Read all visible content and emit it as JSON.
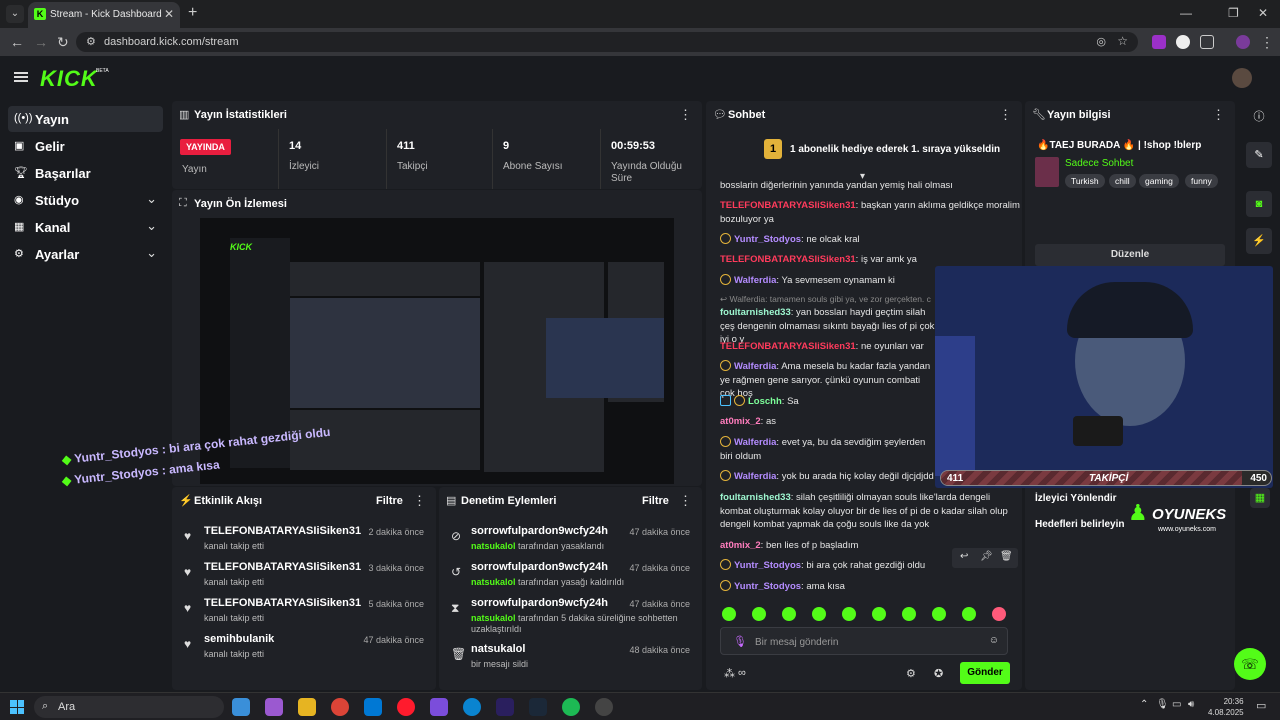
{
  "browser": {
    "tab_title": "Stream - Kick Dashboard",
    "url": "dashboard.kick.com/stream"
  },
  "header": {
    "logo": "KICK",
    "beta": "BETA"
  },
  "sidebar": {
    "items": [
      {
        "label": "Yayın",
        "icon": "broadcast-icon"
      },
      {
        "label": "Gelir",
        "icon": "revenue-icon"
      },
      {
        "label": "Başarılar",
        "icon": "trophy-icon"
      },
      {
        "label": "Stüdyo",
        "icon": "studio-icon"
      },
      {
        "label": "Kanal",
        "icon": "channel-icon"
      },
      {
        "label": "Ayarlar",
        "icon": "gear-icon"
      }
    ]
  },
  "stats": {
    "title": "Yayın İstatistikleri",
    "live_badge": "YAYINDA",
    "live_label": "Yayın",
    "viewers_value": "14",
    "viewers_label": "İzleyici",
    "followers_value": "411",
    "followers_label": "Takipçi",
    "subs_value": "9",
    "subs_label": "Abone Sayısı",
    "uptime_value": "00:59:53",
    "uptime_label_1": "Yayında Olduğu",
    "uptime_label_2": "Süre"
  },
  "preview": {
    "title": "Yayın Ön İzlemesi",
    "overlay_line1": "Yuntr_Stodyos : bi ara çok rahat gezdiği oldu",
    "overlay_line2": "Yuntr_Stodyos : ama kısa"
  },
  "activity": {
    "title": "Etkinlik Akışı",
    "filter": "Filtre",
    "rows": [
      {
        "name": "TELEFONBATARYASIiSiken31",
        "sub": "kanalı takip etti",
        "time": "2 dakika önce"
      },
      {
        "name": "TELEFONBATARYASIiSiken31",
        "sub": "kanalı takip etti",
        "time": "3 dakika önce"
      },
      {
        "name": "TELEFONBATARYASIiSiken31",
        "sub": "kanalı takip etti",
        "time": "5 dakika önce"
      },
      {
        "name": "semihbulanik",
        "sub": "kanalı takip etti",
        "time": "47 dakika önce"
      }
    ]
  },
  "moderation": {
    "title": "Denetim Eylemleri",
    "filter": "Filtre",
    "rows": [
      {
        "name": "sorrowfulpardon9wcfy24h",
        "mod": "natsukalol",
        "sub": "tarafından yasaklandı",
        "time": "47 dakika önce"
      },
      {
        "name": "sorrowfulpardon9wcfy24h",
        "mod": "natsukalol",
        "sub": "tarafından yasağı kaldırıldı",
        "time": "47 dakika önce"
      },
      {
        "name": "sorrowfulpardon9wcfy24h",
        "mod": "natsukalol",
        "sub": "tarafından 5 dakika süreliğine sohbetten",
        "sub2": "uzaklaştırıldı",
        "time": "47 dakika önce"
      },
      {
        "name": "natsukalol",
        "mod": "",
        "sub": "bir mesajı sildi",
        "time": "48 dakika önce"
      }
    ]
  },
  "chat": {
    "title": "Sohbet",
    "pinned": "1 abonelik hediye ederek 1. sıraya yükseldin",
    "pinned_rank": "1",
    "messages": [
      {
        "user": "",
        "cls": "",
        "text": "bosslarin diğerlerinin yanında yandan yemiş hali olması"
      },
      {
        "user": "TELEFONBATARYASIiSiken31",
        "cls": "u-red",
        "text": "başkan yarın aklıma geldikçe moralim bozuluyor ya"
      },
      {
        "user": "Yuntr_Stodyos",
        "cls": "u-purple",
        "text": "ne olcak kral"
      },
      {
        "user": "TELEFONBATARYASIiSiken31",
        "cls": "u-red",
        "text": "iş var amk ya"
      },
      {
        "user": "Walferdia",
        "cls": "u-purple",
        "text": "Ya sevmesem oynamam ki"
      },
      {
        "user": "foultarnished33",
        "cls": "u-mint",
        "text": "yan bossları haydi geçtim silah çeş dengenin olmaması sıkıntı bayağı lies of pi çok iyi o y",
        "reply": "Walferdia: tamamen souls gibi ya, ve zor gerçekten. c"
      },
      {
        "user": "TELEFONBATARYASIiSiken31",
        "cls": "u-red",
        "text": "ne oyunları var"
      },
      {
        "user": "Walferdia",
        "cls": "u-purple",
        "text": "Ama mesela bu kadar fazla yandan ye rağmen gene sarıyor. çünkü oyunun combati çok hoş"
      },
      {
        "user": "Loschh",
        "cls": "u-green",
        "text": "Sa"
      },
      {
        "user": "at0mix_2",
        "cls": "u-pink",
        "text": "as"
      },
      {
        "user": "Walferdia",
        "cls": "u-purple",
        "text": "evet ya, bu da sevdiğim şeylerden biri oldum"
      },
      {
        "user": "Walferdia",
        "cls": "u-purple",
        "text": "yok bu arada hiç kolay değil djcjdjdd"
      },
      {
        "user": "foultarnished33",
        "cls": "u-mint",
        "text": "silah çeşitliliği olmayan souls like'larda dengeli kombat oluşturmak kolay oluyor bir de lies of pi de o kadar silah olup dengeli kombat yapmak da çoğu souls like da yok"
      },
      {
        "user": "at0mix_2",
        "cls": "u-pink",
        "text": "ben lies of p başladım"
      },
      {
        "user": "Yuntr_Stodyos",
        "cls": "u-purple",
        "text": "bi ara çok rahat gezdiği oldu"
      },
      {
        "user": "Yuntr_Stodyos",
        "cls": "u-purple",
        "text": "ama kısa"
      }
    ],
    "input_placeholder": "Bir mesaj gönderin",
    "send_label": "Gönder"
  },
  "stream_info": {
    "title": "Yayın bilgisi",
    "stream_title": "🔥TAEJ BURADA 🔥 | !shop !blerp",
    "category": "Sadece Sohbet",
    "tags": [
      "Turkish",
      "chill",
      "gaming",
      "funny"
    ],
    "edit_label": "Düzenle",
    "link1": "İzleyici Yönlendir",
    "link2": "Hedefleri belirleyin"
  },
  "overlay": {
    "follow_current": "411",
    "follow_label": "TAKİPÇİ",
    "follow_goal": "450",
    "follow_progress": 0.913,
    "brand": "OYUNEKS",
    "brand_url": "www.oyuneks.com"
  },
  "taskbar": {
    "search_label": "Ara",
    "time": "20:36",
    "date": "4.08.2025"
  },
  "colors": {
    "accent": "#53fc18",
    "live": "#e91e3f",
    "panel": "#1f2126"
  }
}
